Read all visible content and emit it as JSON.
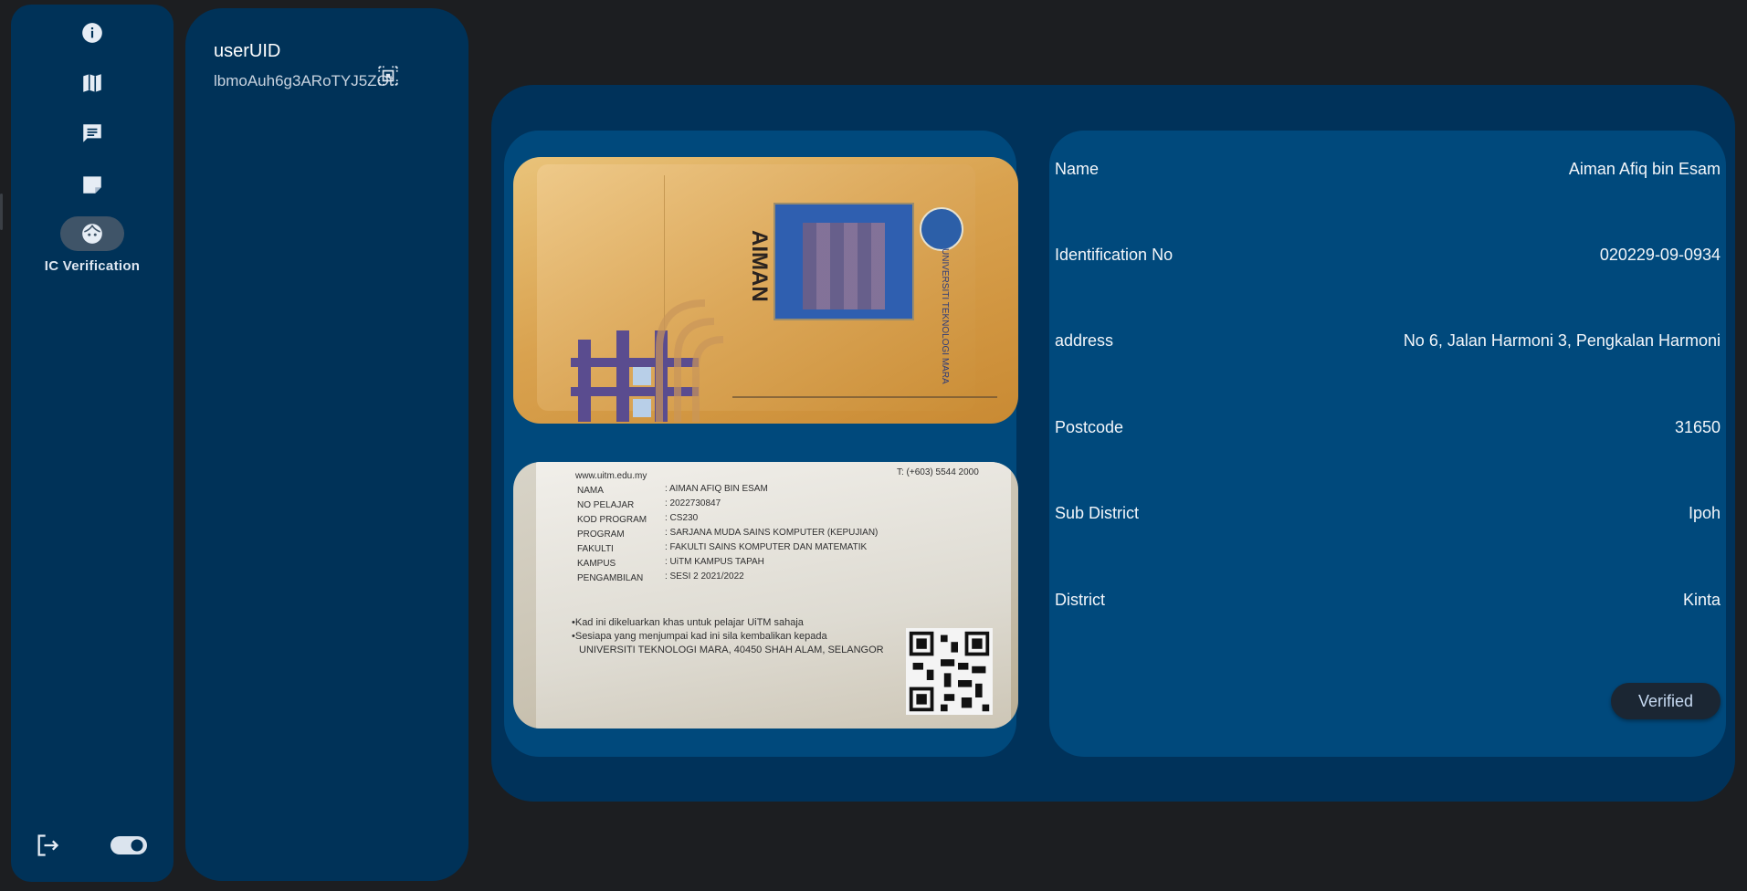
{
  "nav": {
    "items": [
      {
        "icon": "info-icon",
        "label": ""
      },
      {
        "icon": "map-icon",
        "label": ""
      },
      {
        "icon": "chat-icon",
        "label": ""
      },
      {
        "icon": "note-icon",
        "label": ""
      },
      {
        "icon": "face-icon",
        "label": "IC Verification",
        "active": true
      }
    ],
    "bottom": {
      "logout_icon": "logout-icon",
      "theme_toggle": "toggle-icon"
    }
  },
  "list": {
    "title": "userUID",
    "value": "lbmoAuh6g3ARoTYJ5ZOt",
    "action_icon": "scan-icon"
  },
  "details": {
    "fields": [
      {
        "label": "Name",
        "value": "Aiman Afiq bin Esam"
      },
      {
        "label": "Identification No",
        "value": "020229-09-0934"
      },
      {
        "label": "address",
        "value": "No 6, Jalan Harmoni 3, Pengkalan Harmoni"
      },
      {
        "label": "Postcode",
        "value": "31650"
      },
      {
        "label": "Sub District",
        "value": "Ipoh"
      },
      {
        "label": "District",
        "value": "Kinta"
      }
    ],
    "status_button": "Verified"
  },
  "images": {
    "front": {
      "name_vertical": "AIMAN",
      "university": "UNIVERSITI TEKNOLOGI MARA"
    },
    "back": {
      "website": "www.uitm.edu.my",
      "phone": "T: (+603) 5544 2000",
      "rows": [
        {
          "label": "NAMA",
          "value": ": AIMAN AFIQ BIN ESAM"
        },
        {
          "label": "NO PELAJAR",
          "value": ": 2022730847"
        },
        {
          "label": "KOD PROGRAM",
          "value": ": CS230"
        },
        {
          "label": "PROGRAM",
          "value": ": SARJANA MUDA SAINS KOMPUTER (KEPUJIAN)"
        },
        {
          "label": "FAKULTI",
          "value": ": FAKULTI SAINS KOMPUTER DAN MATEMATIK"
        },
        {
          "label": "KAMPUS",
          "value": ": UiTM KAMPUS TAPAH"
        },
        {
          "label": "PENGAMBILAN",
          "value": ": SESI 2 2021/2022"
        }
      ],
      "notes": [
        "•Kad ini dikeluarkan khas untuk pelajar UiTM sahaja",
        "•Sesiapa yang menjumpai kad ini sila kembalikan kepada",
        "UNIVERSITI TEKNOLOGI MARA, 40450 SHAH ALAM, SELANGOR"
      ]
    }
  }
}
